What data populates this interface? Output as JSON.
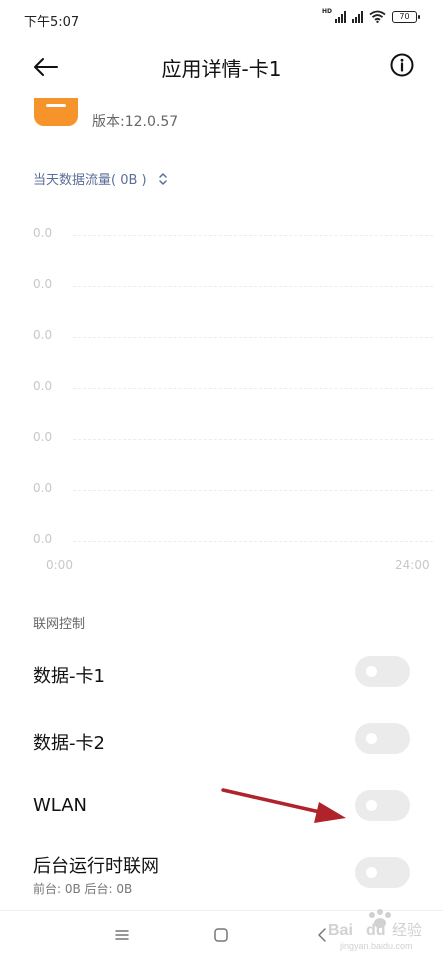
{
  "status_bar": {
    "time": "下午5:07",
    "hd_label": "HD",
    "battery": "70"
  },
  "header": {
    "title": "应用详情-卡1",
    "back_icon": "back-arrow-icon",
    "info_icon": "info-icon"
  },
  "app": {
    "icon": "app-icon",
    "icon_color": "#f7932b",
    "version": "版本:12.0.57"
  },
  "usage": {
    "label": "当天数据流量( 0B )",
    "selector_icon": "chevron-updown-icon"
  },
  "chart_data": {
    "type": "line",
    "x_ticks": [
      "0:00",
      "24:00"
    ],
    "y_ticks": [
      "0.0",
      "0.0",
      "0.0",
      "0.0",
      "0.0",
      "0.0",
      "0.0"
    ],
    "series": [],
    "grid": true
  },
  "network": {
    "section_title": "联网控制",
    "rows": [
      {
        "label": "数据-卡1",
        "enabled": false
      },
      {
        "label": "数据-卡2",
        "enabled": false
      },
      {
        "label": "WLAN",
        "enabled": false
      },
      {
        "label": "后台运行时联网",
        "sub": "前台: 0B  后台: 0B",
        "enabled": false
      }
    ]
  },
  "annotation": {
    "arrow_color": "#b0232a"
  },
  "nav_bar": {
    "items": [
      "menu-icon",
      "home-square-icon",
      "back-chevron-icon"
    ]
  },
  "watermark": {
    "text": "Baidu 经验",
    "url": "jingyan.baidu.com"
  }
}
